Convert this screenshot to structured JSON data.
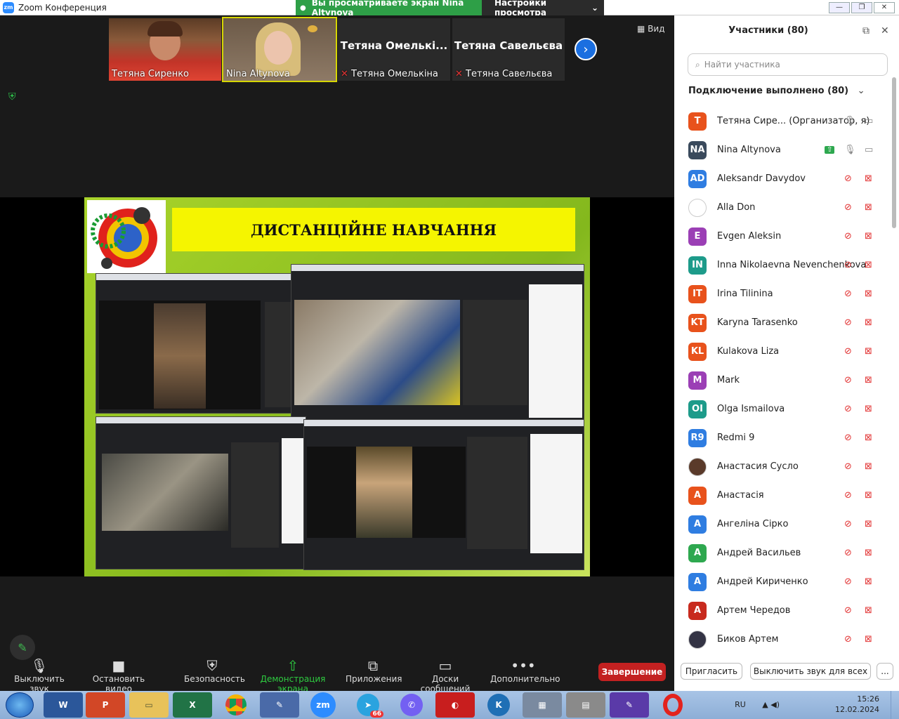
{
  "titlebar": {
    "app_title": "Zoom Конференция",
    "viewing_text": "Вы просматриваете экран Nina Altynova",
    "view_settings": "Настройки просмотра"
  },
  "video_strip": {
    "tiles": [
      {
        "name": "Тетяна Сиренко",
        "has_video": true
      },
      {
        "name": "Nina Altynova",
        "has_video": true
      },
      {
        "name": "Тетяна Омелькіна",
        "big_label": "Тетяна Омелькі...",
        "has_video": false
      },
      {
        "name": "Тетяна Савельєва",
        "big_label": "Тетяна Савельєва",
        "has_video": false
      }
    ],
    "view_label": "Вид"
  },
  "slide": {
    "title": "ДИСТАНЦІЙНЕ НАВЧАННЯ"
  },
  "toolbar": {
    "mute": "Выключить звук",
    "video": "Остановить видео",
    "security": "Безопасность",
    "share": "Демонстрация экрана",
    "apps": "Приложения",
    "boards": "Доски сообщений",
    "more": "Дополнительно",
    "end": "Завершение"
  },
  "participants_panel": {
    "title": "Участники (80)",
    "search_placeholder": "Найти участника",
    "connected_label": "Подключение выполнено (80)",
    "invite": "Пригласить",
    "mute_all": "Выключить звук для всех",
    "more": "...",
    "people": [
      {
        "initials": "T",
        "name": "Тетяна Сире...  (Организатор, я)",
        "color": "#e8521c",
        "muted": false,
        "video_off": false
      },
      {
        "initials": "NA",
        "name": "Nina Altynova",
        "color": "#3a4a5c",
        "muted": false,
        "video_off": false,
        "sharing": true
      },
      {
        "initials": "AD",
        "name": "Aleksandr Davydov",
        "color": "#2f7de1",
        "muted": true,
        "video_off": true
      },
      {
        "initials": "",
        "name": "Alla Don",
        "color": "#ffffff",
        "muted": true,
        "video_off": true,
        "photo": true
      },
      {
        "initials": "E",
        "name": "Evgen Aleksin",
        "color": "#9b3fb5",
        "muted": true,
        "video_off": true
      },
      {
        "initials": "IN",
        "name": "Inna Nikolaevna Nevenchenkova",
        "color": "#1d9b8a",
        "muted": true,
        "video_off": true
      },
      {
        "initials": "IT",
        "name": "Irina Tilinina",
        "color": "#e8521c",
        "muted": true,
        "video_off": true
      },
      {
        "initials": "KT",
        "name": "Karyna Tarasenko",
        "color": "#e8521c",
        "muted": true,
        "video_off": true
      },
      {
        "initials": "KL",
        "name": "Kulakova Liza",
        "color": "#e8521c",
        "muted": true,
        "video_off": true
      },
      {
        "initials": "M",
        "name": "Mark",
        "color": "#9b3fb5",
        "muted": true,
        "video_off": true
      },
      {
        "initials": "OI",
        "name": "Olga Ismailova",
        "color": "#1d9b8a",
        "muted": true,
        "video_off": true
      },
      {
        "initials": "R9",
        "name": "Redmi 9",
        "color": "#2f7de1",
        "muted": true,
        "video_off": true
      },
      {
        "initials": "",
        "name": "Анастасия Сусло",
        "color": "#5a3a2a",
        "muted": true,
        "video_off": true,
        "photo": true
      },
      {
        "initials": "A",
        "name": "Анастасія",
        "color": "#e8521c",
        "muted": true,
        "video_off": true
      },
      {
        "initials": "A",
        "name": "Ангеліна Сірко",
        "color": "#2f7de1",
        "muted": true,
        "video_off": true
      },
      {
        "initials": "A",
        "name": "Андрей Васильев",
        "color": "#2ea84f",
        "muted": true,
        "video_off": true
      },
      {
        "initials": "A",
        "name": "Андрей Кириченко",
        "color": "#2f7de1",
        "muted": true,
        "video_off": true
      },
      {
        "initials": "A",
        "name": "Артем Чередов",
        "color": "#c82a1e",
        "muted": true,
        "video_off": true
      },
      {
        "initials": "",
        "name": "Биков Артем",
        "color": "#333344",
        "muted": true,
        "video_off": true,
        "photo": true
      }
    ]
  },
  "taskbar": {
    "language": "RU",
    "time": "15:26",
    "date": "12.02.2024",
    "telegram_badge": "66"
  }
}
